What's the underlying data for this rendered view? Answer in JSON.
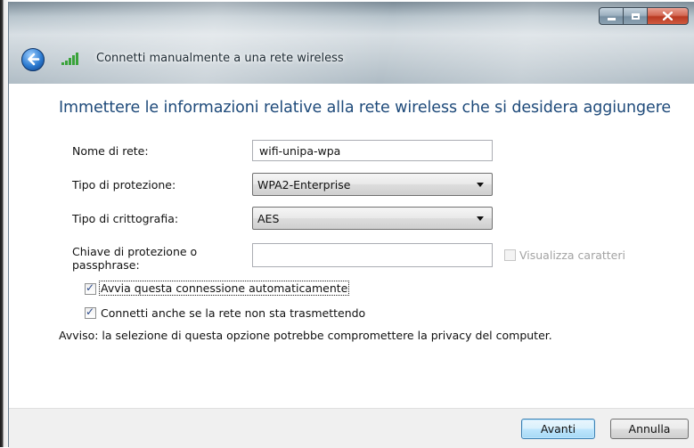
{
  "window": {
    "title": "Connetti manualmente a una rete wireless",
    "caption_buttons": [
      "minimize-icon",
      "maximize-icon",
      "close-icon"
    ]
  },
  "main": {
    "heading": "Immettere le informazioni relative alla rete wireless che si desidera aggiungere",
    "network_name": {
      "label": "Nome di rete:",
      "value": "wifi-unipa-wpa"
    },
    "security_type": {
      "label": "Tipo di protezione:",
      "selected": "WPA2-Enterprise"
    },
    "encryption_type": {
      "label": "Tipo di crittografia:",
      "selected": "AES"
    },
    "security_key": {
      "label_line1": "Chiave di protezione o",
      "label_line2": "passphrase:",
      "value": "",
      "show_characters_label": "Visualizza caratteri",
      "show_characters_checked": false,
      "show_characters_enabled": false
    },
    "auto_connect": {
      "label": "Avvia questa connessione automaticamente",
      "checked": true
    },
    "connect_hidden": {
      "label": "Connetti anche se la rete non sta trasmettendo",
      "checked": true
    },
    "warning": "Avviso: la selezione di questa opzione potrebbe compromettere la privacy del computer."
  },
  "footer": {
    "next_label": "Avanti",
    "cancel_label": "Annulla"
  },
  "colors": {
    "heading": "#1e4a7a",
    "footer_bg": "#f0f0f0",
    "default_button_border": "#3c7fb1"
  }
}
